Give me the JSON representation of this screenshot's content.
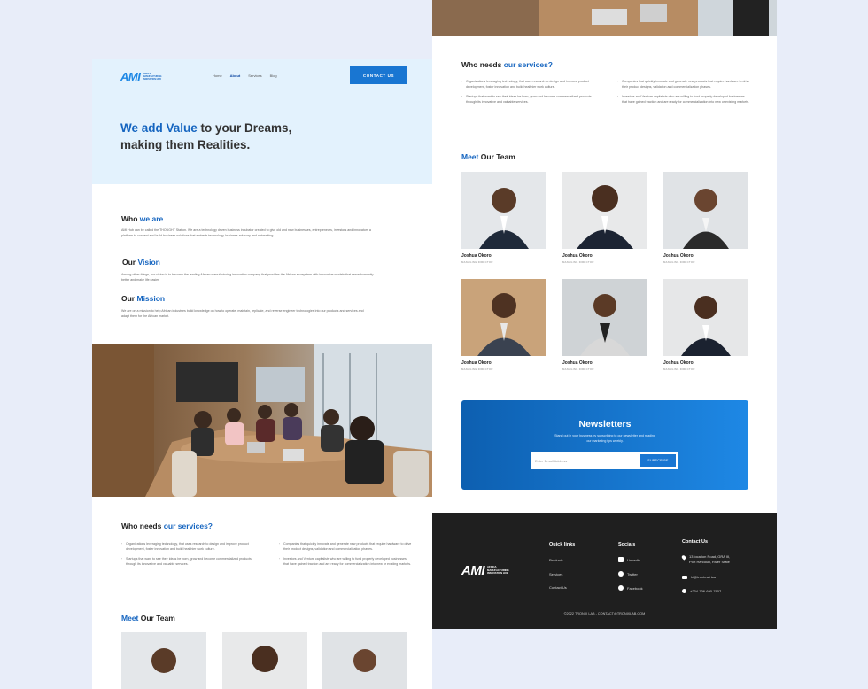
{
  "brand": {
    "logo_text": "AMI",
    "logo_subtext": "AFRICA MANUFACTURING INNOVATION HUB"
  },
  "nav": {
    "items": [
      "Home",
      "About",
      "Services",
      "Blog"
    ],
    "active": "About",
    "contact_label": "CONTACT US"
  },
  "hero": {
    "headline_accent": "We add Value",
    "headline_rest_1": " to your Dreams,",
    "headline_line_2": "making them Realities."
  },
  "who_we_are": {
    "title_plain": "Who ",
    "title_accent": "we are",
    "body": "AMI Hub can be called the THOUGHT Station. We are a technology driven business incubator created to give old and new businesses, entrepreneurs, investors and innovators a platform to connect and build business solutions that embeds technology, business advisory and networking."
  },
  "vision": {
    "title_plain": "Our ",
    "title_accent": "Vision",
    "body": "Among other things, our vision is to become the leading African manufacturing innovation company that provides the African ecosystem with innovative models that serve humanity better and make life easier."
  },
  "mission": {
    "title_plain": "Our ",
    "title_accent": "Mission",
    "body": "We are on a mission to help African industries build knowledge on how to operate, maintain, replicate, and reverse engineer technologies into our products and services and adapt them for the African market."
  },
  "services": {
    "title_plain": "Who needs ",
    "title_accent": "our services?",
    "bullets_left": [
      "Organizations leveraging technology, that uses research to design and improve product development, foster innovation and build healthier work culture.",
      "Startups that want to see their ideas be born, grow and become commercialized products through its innovative and valuable services."
    ],
    "bullets_right": [
      "Companies that quickly innovate and generate new products that require hardware to drive their product designs, validation and commercialization phases.",
      "Investors and Venture capitalists who are willing to fund properly developed businesses that have gained traction and are ready for commercialization into new or existing markets."
    ]
  },
  "team": {
    "title_accent": "Meet",
    "title_plain": " Our Team",
    "members": [
      {
        "name": "Joshua Okoro",
        "role": "MANAGING DIRECTOR"
      },
      {
        "name": "Joshua Okoro",
        "role": "MANAGING DIRECTOR"
      },
      {
        "name": "Joshua Okoro",
        "role": "MANAGING DIRECTOR"
      },
      {
        "name": "Joshua Okoro",
        "role": "MANAGING DIRECTOR"
      },
      {
        "name": "Joshua Okoro",
        "role": "MANAGING DIRECTOR"
      },
      {
        "name": "Joshua Okoro",
        "role": "MANAGING DIRECTOR"
      }
    ]
  },
  "newsletter": {
    "title": "Newsletters",
    "body": "Stand out in your business by subscribing to our newsletter and reading our marketing tips weekly.",
    "email_placeholder": "Enter Email Address",
    "subscribe_label": "SUBSCRIBE"
  },
  "footer": {
    "quick_links_title": "Quick links",
    "quick_links": [
      "Products",
      "Services",
      "Contact Us"
    ],
    "socials_title": "Socials",
    "socials": [
      {
        "label": "Linkedin",
        "icon": "linkedin-icon"
      },
      {
        "label": "Twitter",
        "icon": "twitter-icon"
      },
      {
        "label": "Facebook",
        "icon": "facebook-icon"
      }
    ],
    "contact_title": "Contact Us",
    "address_line_1": "13 location Road, GRA III,",
    "address_line_2": "Port Harcourt, River State",
    "email": "hi@tronix.africa",
    "phone": "+234-706-690-7907",
    "copyright": "©2022 TRONIX LAB - CONTACT@TRONIXLAB.COM"
  },
  "colors": {
    "accent": "#1565c0",
    "hero_bg": "#e3f2fd",
    "page_bg": "#e8edf9",
    "footer_bg": "#1f1f1f"
  }
}
